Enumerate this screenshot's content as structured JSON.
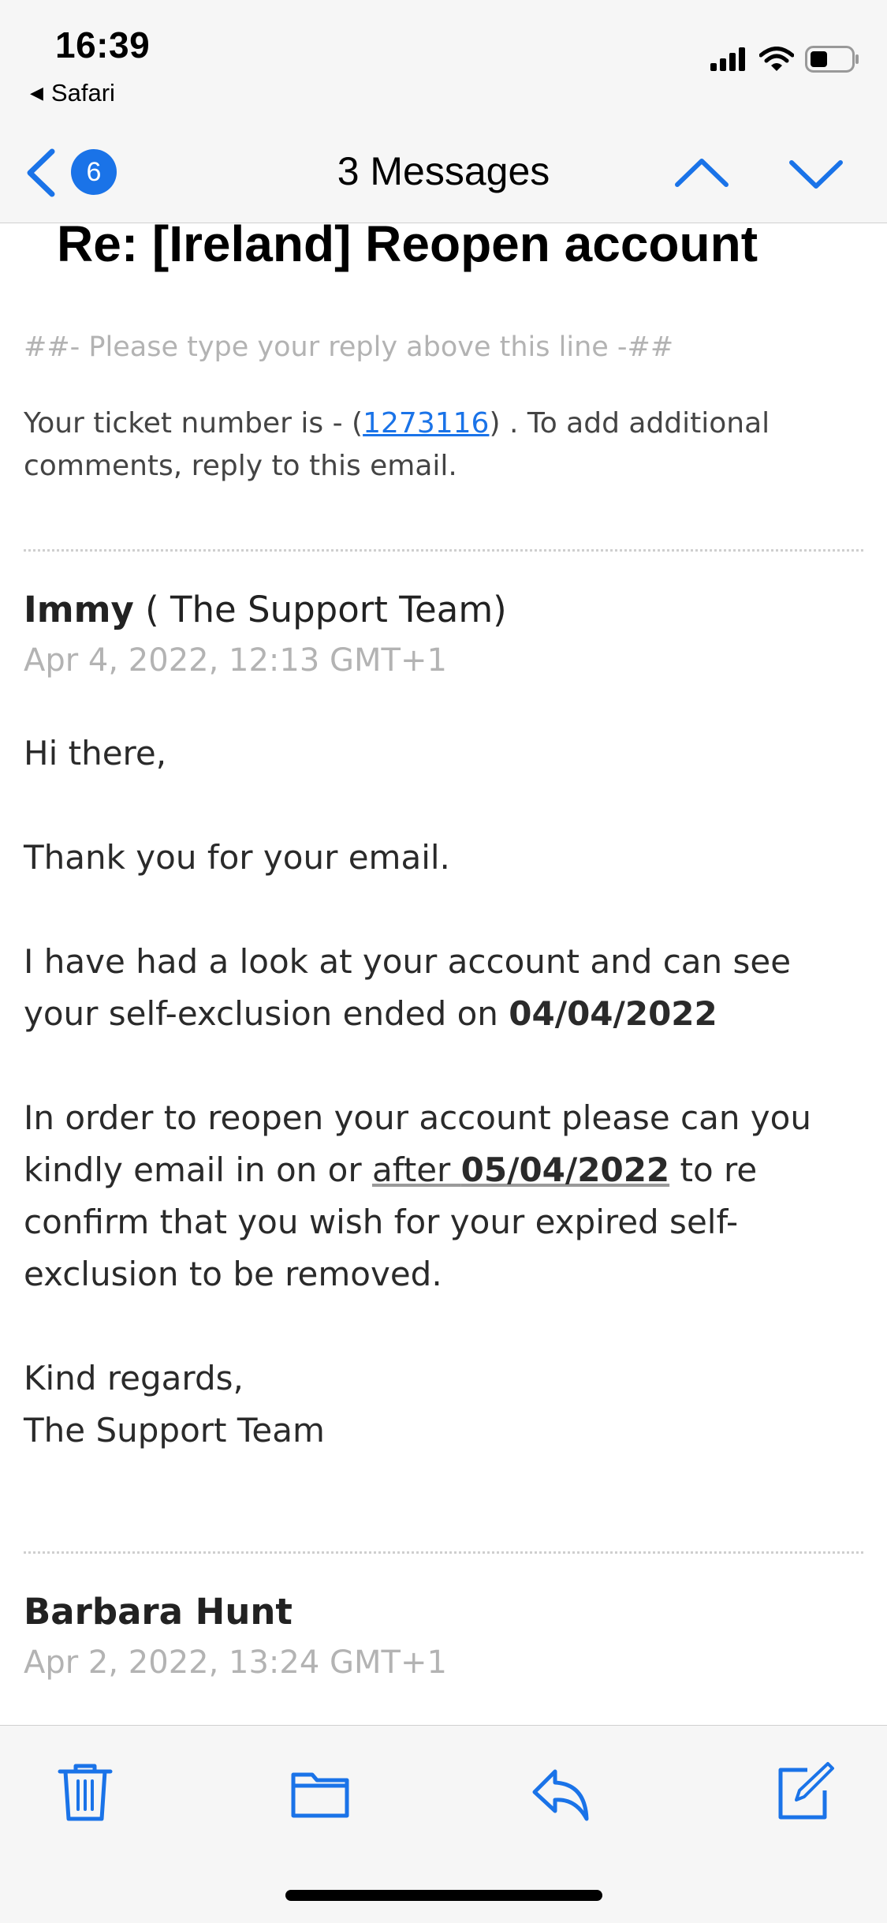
{
  "status": {
    "time": "16:39",
    "back_app": "Safari"
  },
  "nav": {
    "badge_count": "6",
    "title": "3 Messages"
  },
  "email": {
    "subject": "Re: [Ireland] Reopen account",
    "reply_line": "##- Please type your reply above this line -##",
    "ticket_prefix": "Your ticket number is - (",
    "ticket_number": "1273116",
    "ticket_suffix": ") . To add additional comments, reply to this email.",
    "messages": [
      {
        "sender_name": "Immy",
        "sender_team": " ( The Support Team)",
        "date": "Apr 4, 2022, 12:13 GMT+1",
        "greeting": "Hi there,",
        "thanks": "Thank you for your email.",
        "para1_text": "I have had a look at your account and can see your self-exclusion ended on ",
        "para1_date": "04/04/2022",
        "para2_pre": "In order to reopen your account please can you kindly email in on or ",
        "para2_after": "after ",
        "para2_date": "05/04/2022",
        "para2_post": " to re confirm that you wish for your expired self-exclusion to be removed.",
        "signoff": "Kind regards,",
        "signature": "The Support Team"
      },
      {
        "sender_name": "Barbara Hunt",
        "date": "Apr 2, 2022, 13:24 GMT+1"
      }
    ]
  },
  "toolbar": {
    "icons": [
      "trash-icon",
      "folder-icon",
      "reply-icon",
      "compose-icon"
    ]
  },
  "colors": {
    "accent": "#1a73e8",
    "bar_bg": "#f6f6f6",
    "muted_text": "#b3b3b3"
  }
}
